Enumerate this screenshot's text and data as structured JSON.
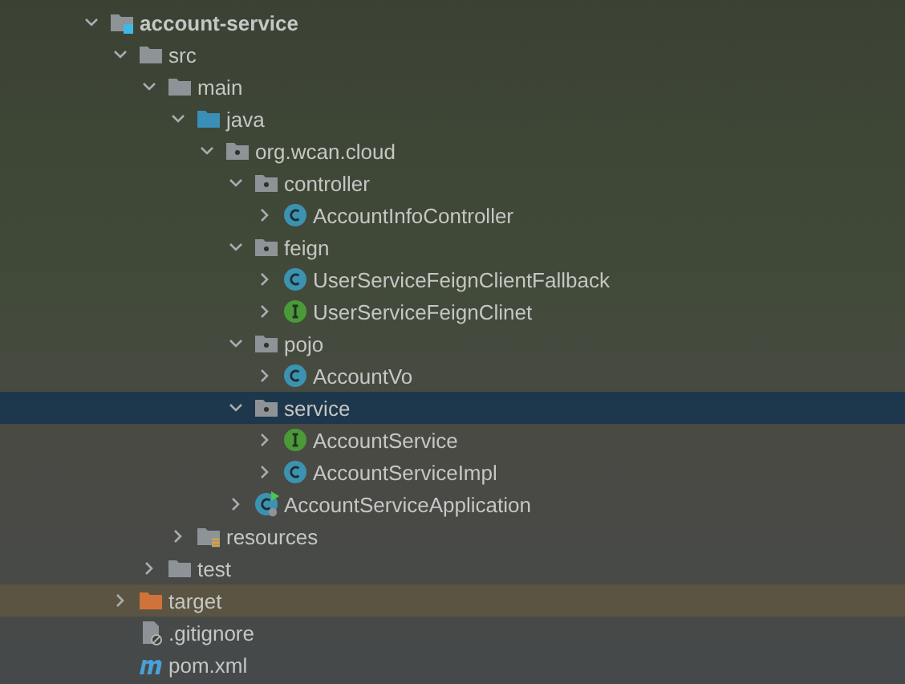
{
  "tree": [
    {
      "kind": "module",
      "label": "account-service",
      "expanded": true,
      "selected": false,
      "children": [
        {
          "kind": "folder",
          "label": "src",
          "expanded": true,
          "selected": false,
          "children": [
            {
              "kind": "folder",
              "label": "main",
              "expanded": true,
              "selected": false,
              "children": [
                {
                  "kind": "source-root",
                  "label": "java",
                  "expanded": true,
                  "selected": false,
                  "children": [
                    {
                      "kind": "package",
                      "label": "org.wcan.cloud",
                      "expanded": true,
                      "selected": false,
                      "children": [
                        {
                          "kind": "package",
                          "label": "controller",
                          "expanded": true,
                          "selected": false,
                          "children": [
                            {
                              "kind": "class",
                              "label": "AccountInfoController",
                              "expanded": false,
                              "selected": false
                            }
                          ]
                        },
                        {
                          "kind": "package",
                          "label": "feign",
                          "expanded": true,
                          "selected": false,
                          "children": [
                            {
                              "kind": "class",
                              "label": "UserServiceFeignClientFallback",
                              "expanded": false,
                              "selected": false
                            },
                            {
                              "kind": "interface",
                              "label": "UserServiceFeignClinet",
                              "expanded": false,
                              "selected": false
                            }
                          ]
                        },
                        {
                          "kind": "package",
                          "label": "pojo",
                          "expanded": true,
                          "selected": false,
                          "children": [
                            {
                              "kind": "class",
                              "label": "AccountVo",
                              "expanded": false,
                              "selected": false
                            }
                          ]
                        },
                        {
                          "kind": "package",
                          "label": "service",
                          "expanded": true,
                          "selected": true,
                          "children": [
                            {
                              "kind": "interface",
                              "label": "AccountService",
                              "expanded": false,
                              "selected": false
                            },
                            {
                              "kind": "class",
                              "label": "AccountServiceImpl",
                              "expanded": false,
                              "selected": false
                            }
                          ]
                        },
                        {
                          "kind": "app",
                          "label": "AccountServiceApplication",
                          "expanded": false,
                          "selected": false
                        }
                      ]
                    }
                  ]
                },
                {
                  "kind": "resources",
                  "label": "resources",
                  "expanded": false,
                  "selected": false
                }
              ]
            },
            {
              "kind": "folder",
              "label": "test",
              "expanded": false,
              "selected": false
            }
          ]
        },
        {
          "kind": "excluded",
          "label": "target",
          "expanded": false,
          "selected": false
        },
        {
          "kind": "gitignore",
          "label": ".gitignore",
          "selected": false
        },
        {
          "kind": "maven",
          "label": "pom.xml",
          "selected": false
        }
      ]
    }
  ]
}
